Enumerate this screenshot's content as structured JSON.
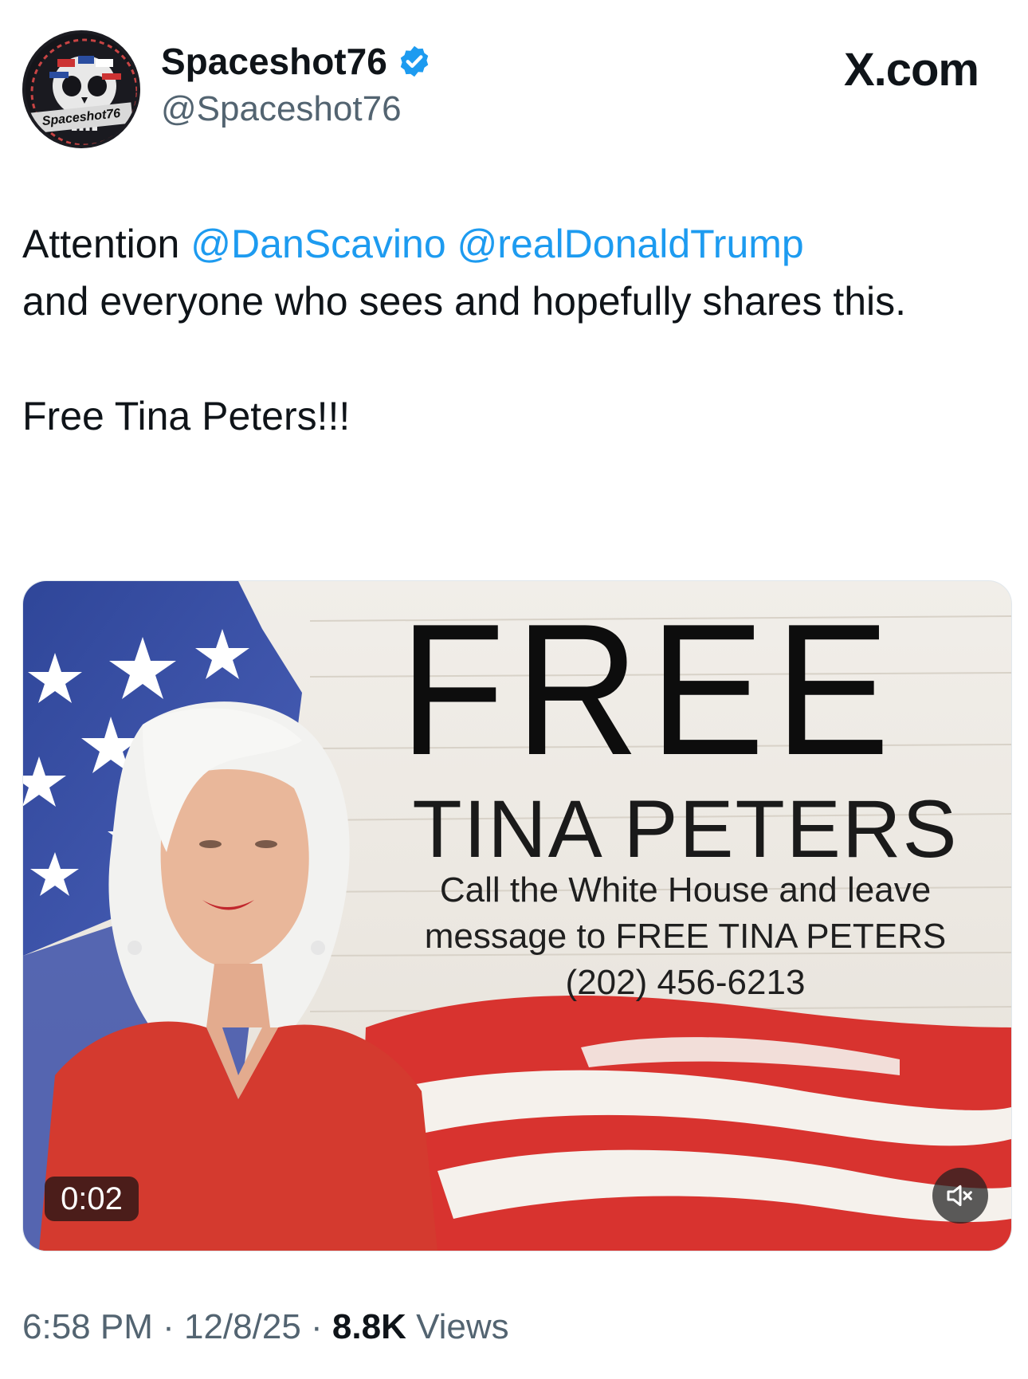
{
  "header": {
    "avatar_label": "Spaceshot76",
    "display_name": "Spaceshot76",
    "handle": "@Spaceshot76",
    "brand": "X.com",
    "verified_color": "#1d9bf0"
  },
  "tweet": {
    "line1_prefix": "Attention ",
    "mention1": "@DanScavino",
    "mention2": "@realDonaldTrump",
    "line1_rest": "and everyone who sees and hopefully shares this.",
    "line2": "Free Tina Peters!!!"
  },
  "media": {
    "headline_free": "FREE",
    "headline_name": "TINA PETERS",
    "sub_line1": "Call the White House and leave",
    "sub_line2": "message to FREE TINA PETERS",
    "phone": "(202) 456-6213",
    "duration": "0:02",
    "mute_icon": "speaker-muted-icon"
  },
  "meta": {
    "time": "6:58 PM",
    "sep": " · ",
    "date": "12/8/25",
    "views_count": "8.8K",
    "views_label": " Views"
  },
  "colors": {
    "mention": "#1d9bf0",
    "secondary_text": "#536471",
    "flag_red": "#d8332f",
    "flag_blue": "#3b4fa8"
  }
}
